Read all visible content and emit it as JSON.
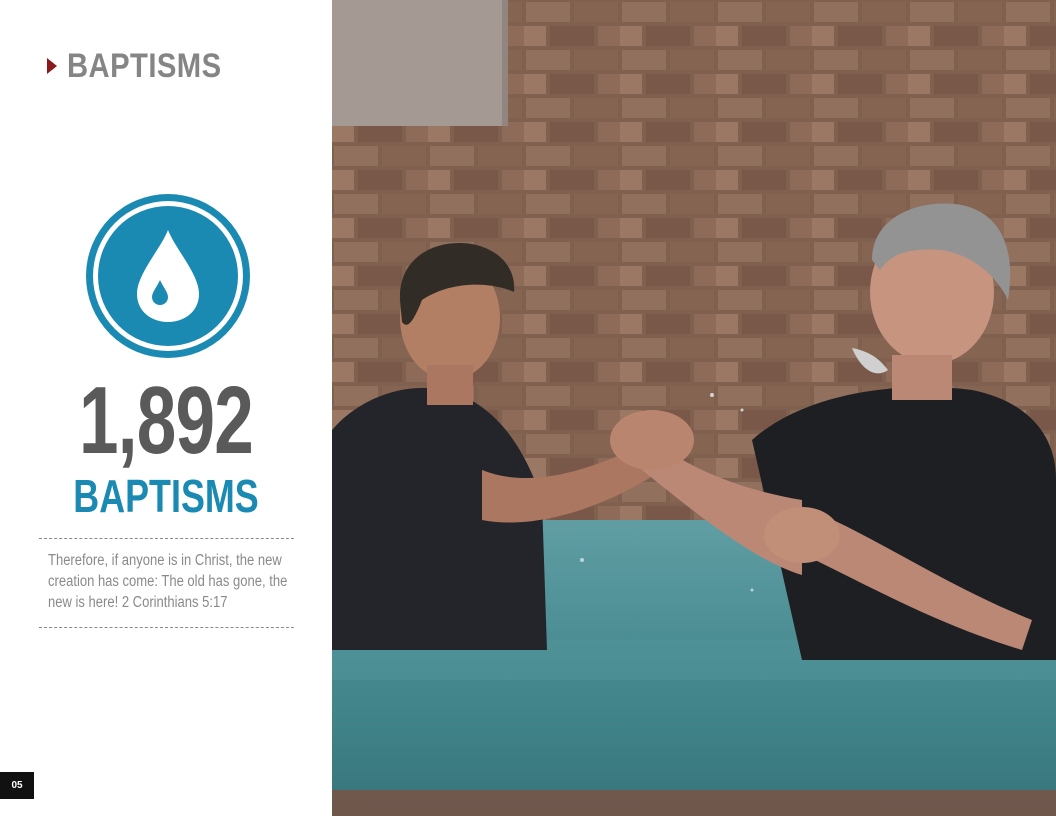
{
  "section": {
    "title": "BAPTISMS"
  },
  "stat": {
    "number": "1,892",
    "label": "BAPTISMS",
    "icon": "water-drop-icon"
  },
  "verse": {
    "lines": [
      "Therefore, if anyone is in Christ, the new",
      "creation has come: The old has gone, the",
      "new is here!  2 Corinthians 5:17"
    ]
  },
  "page_number": "05",
  "colors": {
    "accent_red": "#8b1a1a",
    "accent_blue": "#1a8ab3",
    "heading_gray": "#858585",
    "number_gray": "#5a5a5a"
  }
}
